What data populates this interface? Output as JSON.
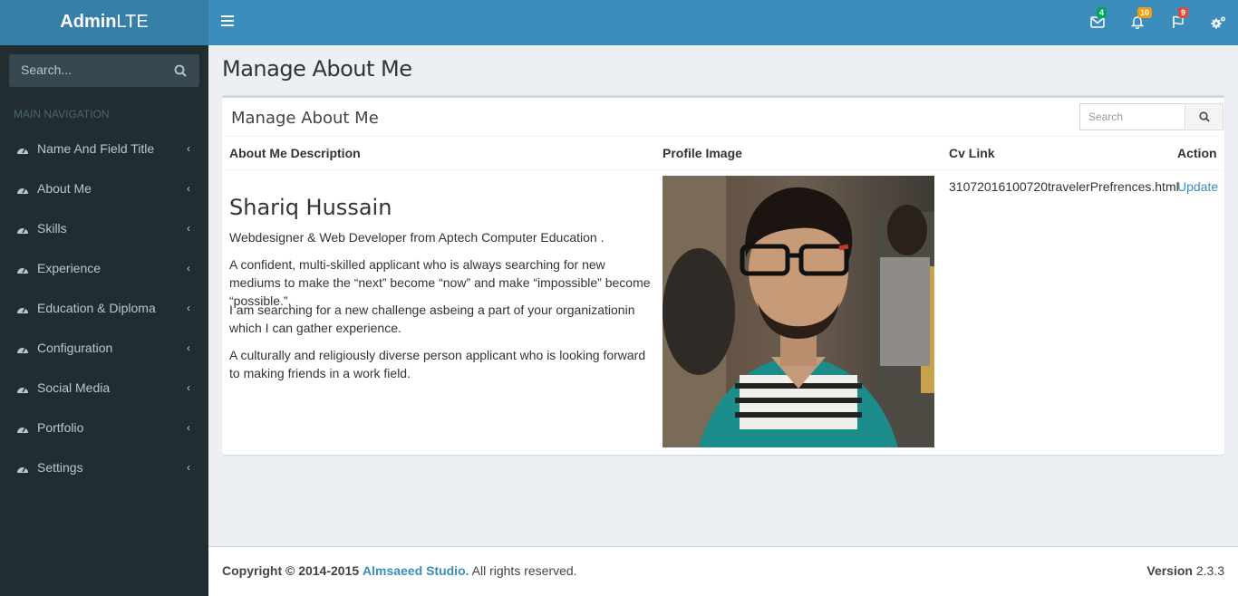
{
  "brand": {
    "bold": "Admin",
    "light": "LTE"
  },
  "sidebar": {
    "search_placeholder": "Search...",
    "header": "MAIN NAVIGATION",
    "items": [
      {
        "label": "Name And Field Title"
      },
      {
        "label": "About Me"
      },
      {
        "label": "Skills"
      },
      {
        "label": "Experience"
      },
      {
        "label": "Education & Diploma"
      },
      {
        "label": "Configuration"
      },
      {
        "label": "Social Media"
      },
      {
        "label": "Portfolio"
      },
      {
        "label": "Settings"
      }
    ]
  },
  "navbar": {
    "messages_count": "4",
    "notifications_count": "10",
    "tasks_count": "9",
    "colors": {
      "messages": "#00a65a",
      "notifications": "#f39c12",
      "tasks": "#dd4b39"
    }
  },
  "page": {
    "title": "Manage About Me"
  },
  "box": {
    "title": "Manage About Me",
    "search_placeholder": "Search",
    "columns": [
      "About Me Description",
      "Profile Image",
      "Cv Link",
      "Action"
    ],
    "row": {
      "name": "Shariq Hussain",
      "paragraphs": [
        "Webdesigner & Web Developer from Aptech Computer Education .",
        "A confident, multi-skilled applicant who is always searching for new mediums to make the “next” become “now” and make “impossible” become “possible.”.",
        "I am searching for a new challenge asbeing a part of your organizationin which I can gather experience.",
        "A culturally and religiously diverse person applicant who is looking forward to making friends in a work field."
      ],
      "cv_link": "31072016100720travelerPrefrences.html",
      "action": "Update"
    }
  },
  "footer": {
    "copyright": "Copyright © 2014-2015",
    "studio": "Almsaeed Studio.",
    "rights": "All rights reserved.",
    "version_label": "Version",
    "version": "2.3.3"
  }
}
